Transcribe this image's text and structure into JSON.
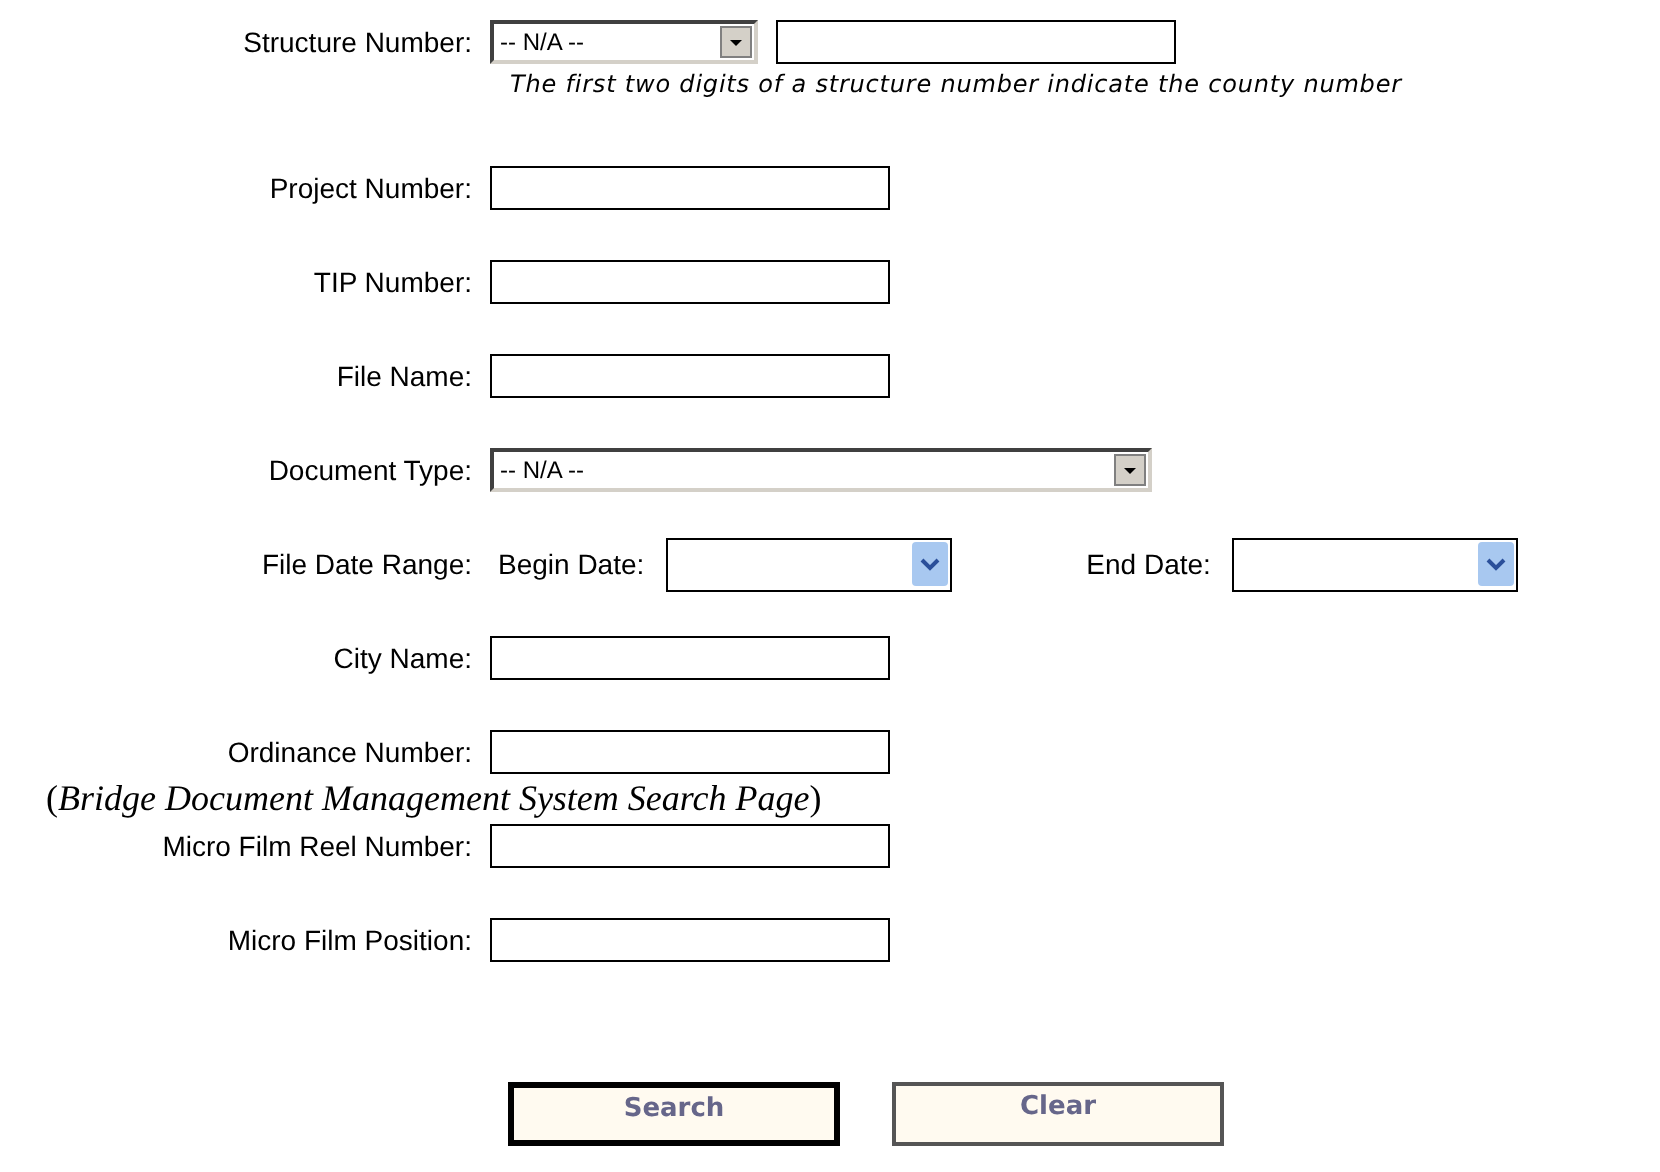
{
  "fields": [
    {
      "kind": "select-text",
      "label": "Structure Number:",
      "value": "-- N/A --",
      "hint": "The first two digits of a structure number indicate the county number"
    },
    {
      "kind": "text",
      "label": "Project Number:"
    },
    {
      "kind": "text",
      "label": "TIP Number:"
    },
    {
      "kind": "text",
      "label": "File Name:"
    },
    {
      "kind": "select",
      "label": "Document Type:",
      "value": "-- N/A --"
    },
    {
      "kind": "daterange",
      "label": "File Date Range:",
      "begin_label": "Begin Date:",
      "end_label": "End Date:"
    },
    {
      "kind": "text",
      "label": "City Name:"
    },
    {
      "kind": "text",
      "label": "Ordinance Number:"
    },
    {
      "kind": "text",
      "label": "Micro Film Reel Number:"
    },
    {
      "kind": "text",
      "label": "Micro Film Position:"
    }
  ],
  "buttons": [
    {
      "label": "Search",
      "focused": true
    },
    {
      "label": "Clear",
      "focused": false
    }
  ],
  "caption": "(*Bridge Document Management System Search Page*)"
}
